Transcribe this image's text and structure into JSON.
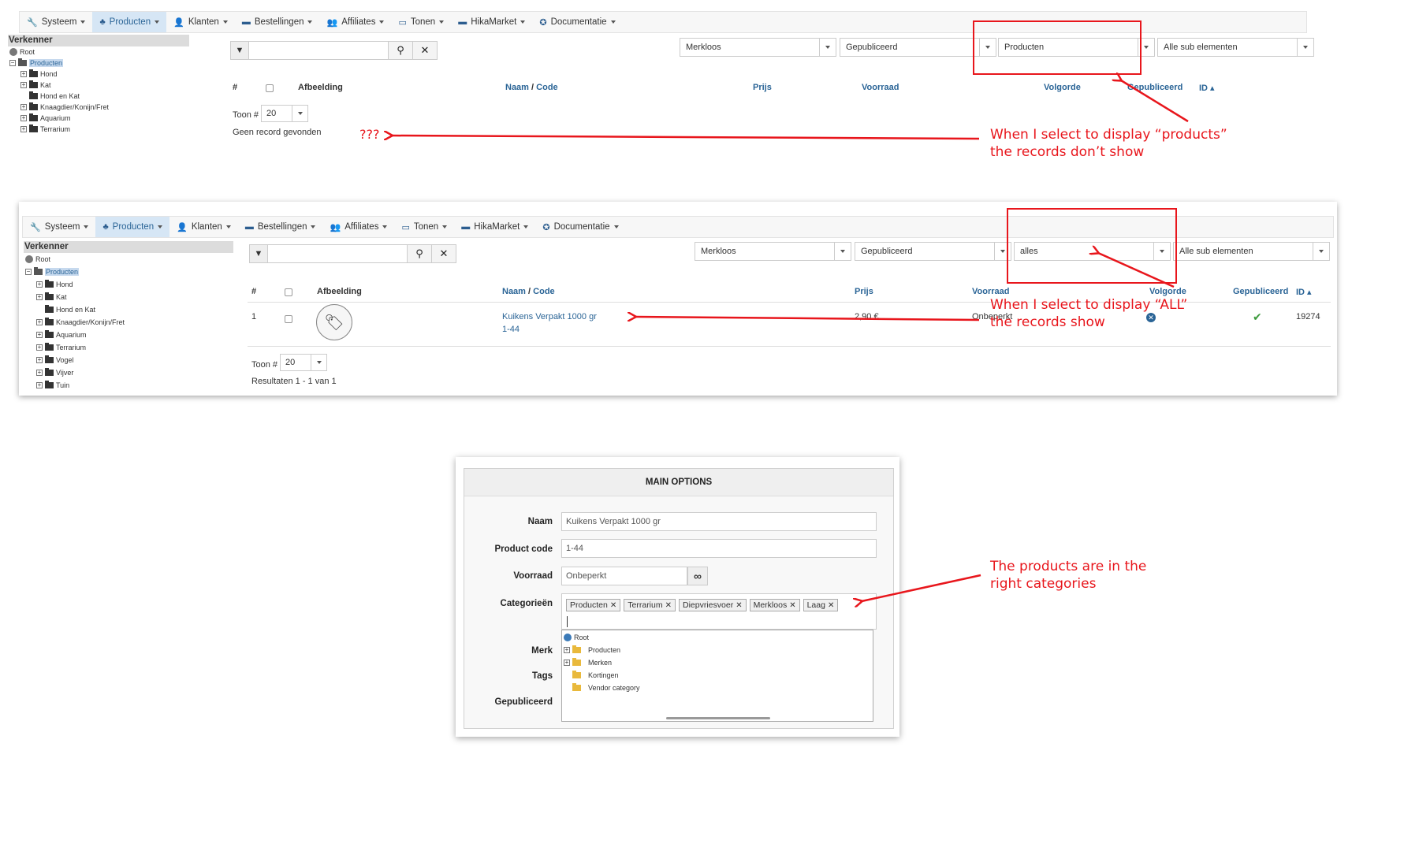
{
  "menu": {
    "items": [
      {
        "label": "Systeem",
        "icon": "wrench-icon",
        "glyph": "🔧"
      },
      {
        "label": "Producten",
        "icon": "boxes-icon",
        "glyph": "♣"
      },
      {
        "label": "Klanten",
        "icon": "user-icon",
        "glyph": "👤"
      },
      {
        "label": "Bestellingen",
        "icon": "credit-card-icon",
        "glyph": "▬"
      },
      {
        "label": "Affiliates",
        "icon": "users-icon",
        "glyph": "👥"
      },
      {
        "label": "Tonen",
        "icon": "monitor-icon",
        "glyph": "▭"
      },
      {
        "label": "HikaMarket",
        "icon": "store-icon",
        "glyph": "▬"
      },
      {
        "label": "Documentatie",
        "icon": "lifebuoy-icon",
        "glyph": "✪"
      }
    ]
  },
  "explorer": {
    "title": "Verkenner",
    "root": "Root",
    "producten": "Producten",
    "items": [
      "Hond",
      "Kat",
      "Hond en Kat",
      "Knaagdier/Konijn/Fret",
      "Aquarium",
      "Terrarium",
      "Vogel",
      "Vijver",
      "Tuin"
    ]
  },
  "filters": {
    "brand": "Merkloos",
    "published": "Gepubliceerd",
    "type_shot1": "Producten",
    "type_shot2": "alles",
    "sub": "Alle sub elementen"
  },
  "table": {
    "headers": {
      "num": "#",
      "image": "Afbeelding",
      "name": "Naam",
      "slash": "/",
      "code": "Code",
      "price": "Prijs",
      "stock": "Voorraad",
      "order": "Volgorde",
      "published": "Gepubliceerd",
      "id": "ID ▴"
    },
    "show_label": "Toon #",
    "show_value": "20",
    "no_records": "Geen record gevonden",
    "results": "Resultaten 1 - 1 van 1",
    "row": {
      "num": "1",
      "name": "Kuikens Verpakt 1000 gr",
      "code": "1-44",
      "price": "2,90 €",
      "stock": "Onbeperkt",
      "id": "19274"
    }
  },
  "annotations": {
    "qqq": "???",
    "products_line1": "When I select to display “products”",
    "products_line2": "the records don’t  show",
    "all_line1": "When I select to display “ALL”",
    "all_line2": "the records show",
    "cat_line1": "The products are in the",
    "cat_line2": "right categories",
    "color": "#e8161c"
  },
  "options": {
    "title": "MAIN OPTIONS",
    "name_label": "Naam",
    "name_value": "Kuikens Verpakt 1000 gr",
    "code_label": "Product code",
    "code_value": "1-44",
    "stock_label": "Voorraad",
    "stock_value": "Onbeperkt",
    "categories_label": "Categorieën",
    "categories": [
      "Producten",
      "Terrarium",
      "Diepvriesvoer",
      "Merkloos",
      "Laag"
    ],
    "brand_label": "Merk",
    "tags_label": "Tags",
    "published_label": "Gepubliceerd",
    "tree": [
      "Root",
      "Producten",
      "Merken",
      "Kortingen",
      "Vendor category"
    ]
  }
}
